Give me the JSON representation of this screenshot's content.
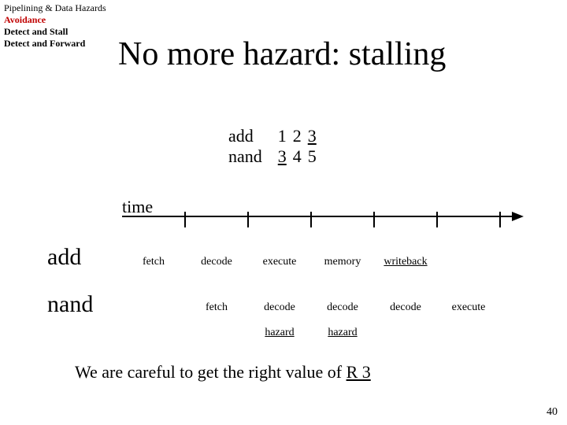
{
  "breadcrumb": {
    "line1": "Pipelining & Data Hazards",
    "avoidance": "Avoidance",
    "stall": "Detect and Stall",
    "forward": "Detect and Forward"
  },
  "title": "No more hazard: stalling",
  "instructions": {
    "add": {
      "label": "add",
      "r1": "1",
      "r2": "2",
      "r3": "3"
    },
    "nand": {
      "label": "nand",
      "r1": "3",
      "r2": "4",
      "r3": "5"
    }
  },
  "time_label": "time",
  "rows": {
    "add_label": "add",
    "nand_label": "nand"
  },
  "stages_row1": {
    "c0": "fetch",
    "c1": "decode",
    "c2": "execute",
    "c3": "memory",
    "c4": "writeback",
    "c5": ""
  },
  "stages_row2": {
    "c0": "",
    "c1": "fetch",
    "c2": "decode",
    "c3": "decode",
    "c4": "decode",
    "c5": "execute"
  },
  "hazard_row": {
    "c0": "",
    "c1": "",
    "c2": "hazard",
    "c3": "hazard",
    "c4": "",
    "c5": ""
  },
  "sentence": {
    "pre": "We are careful to get the right value of ",
    "reg": "R 3"
  },
  "page": "40"
}
